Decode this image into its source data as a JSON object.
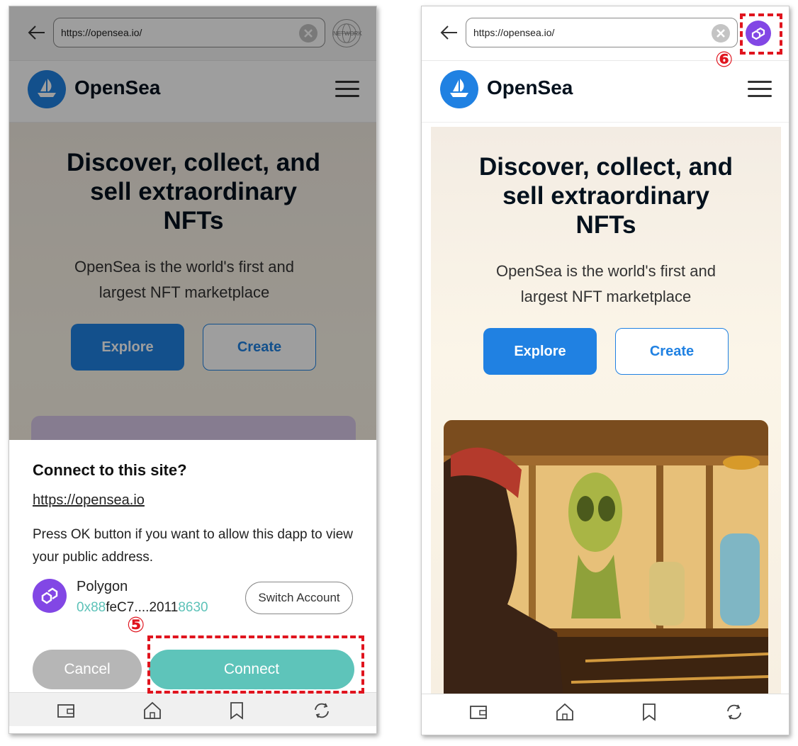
{
  "browser": {
    "url": "https://opensea.io/",
    "network_label": "NETWORK"
  },
  "site": {
    "brand": "OpenSea",
    "hero_title_line1": "Discover, collect, and",
    "hero_title_line2": "sell extraordinary",
    "hero_title_line3": "NFTs",
    "hero_sub_line1": "OpenSea is the world's first and",
    "hero_sub_line2": "largest NFT marketplace",
    "explore_label": "Explore",
    "create_label": "Create"
  },
  "dialog": {
    "title": "Connect to this site?",
    "url": "https://opensea.io",
    "message": "Press OK button if you want to allow this dapp to view your public address.",
    "account_name": "Polygon",
    "address_prefix": "0x88",
    "address_middle": "feC7....2011",
    "address_suffix": "8630",
    "switch_label": "Switch Account",
    "cancel_label": "Cancel",
    "connect_label": "Connect"
  },
  "annotations": {
    "step5": "⑤",
    "step6": "⑥"
  },
  "icons": {
    "back": "back-arrow-icon",
    "clear": "clear-x-icon",
    "network": "globe-network-icon",
    "polygon": "polygon-icon",
    "menu": "hamburger-menu-icon",
    "wallet": "wallet-icon",
    "home": "home-icon",
    "bookmark": "bookmark-icon",
    "refresh": "refresh-icon"
  },
  "colors": {
    "opensea_blue": "#2081e2",
    "polygon_purple": "#8247e5",
    "connect_teal": "#5ec4ba",
    "annotation_red": "#e0141e"
  }
}
